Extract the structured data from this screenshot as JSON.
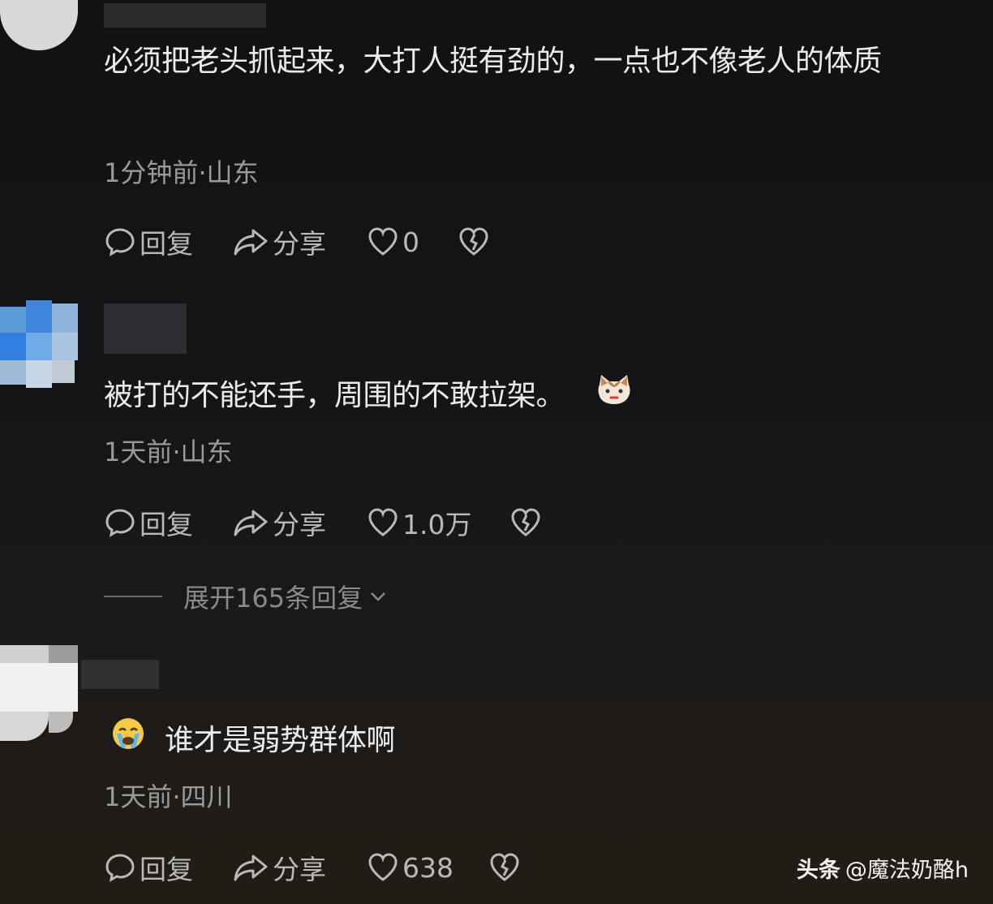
{
  "comments": [
    {
      "text": "必须把老头抓起来，大打人挺有劲的，一点也不像老人的体质",
      "meta": "1分钟前·山东",
      "reply_label": "回复",
      "share_label": "分享",
      "likes": "0"
    },
    {
      "text": "被打的不能还手，周围的不敢拉架。",
      "meta": "1天前·山东",
      "reply_label": "回复",
      "share_label": "分享",
      "likes": "1.0万",
      "emoji_icon": "cat-face-icon",
      "expand_label": "展开165条回复"
    },
    {
      "text": "谁才是弱势群体啊",
      "meta": "1天前·四川",
      "reply_label": "回复",
      "share_label": "分享",
      "likes": "638",
      "emoji_icon": "crying-face-icon"
    }
  ],
  "watermark": {
    "brand": "头条",
    "handle": "@魔法奶酪h"
  },
  "icons": {
    "reply": "speech-bubble-icon",
    "share": "share-arrow-icon",
    "like": "heart-outline-icon",
    "dislike": "broken-heart-icon",
    "expand": "chevron-down-icon"
  }
}
